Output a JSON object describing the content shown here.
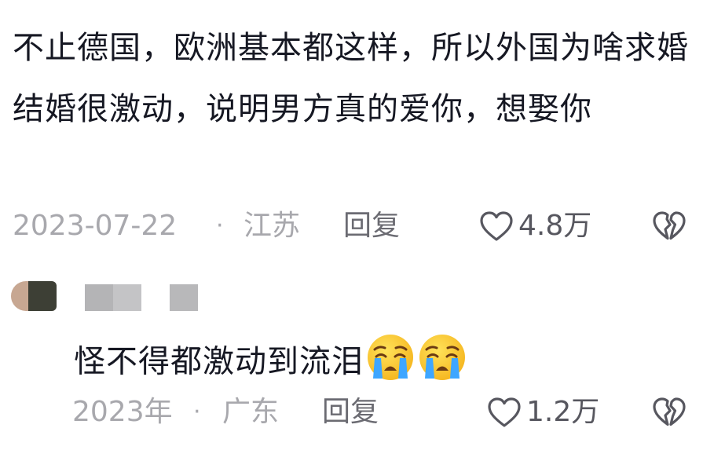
{
  "comment": {
    "text": "不止德国，欧洲基本都这样，所以外国为啥求婚结婚很激动，说明男方真的爱你，想娶你",
    "date": "2023-07-22",
    "separator": "·",
    "location": "江苏",
    "reply_label": "回复",
    "like_count": "4.8万",
    "like_icon": "heart-outline-icon",
    "dislike_icon": "broken-heart-icon"
  },
  "reply": {
    "text": "怪不得都激动到流泪",
    "emojis": [
      "crying-face-emoji",
      "crying-face-emoji"
    ],
    "date": "2023年",
    "separator": "·",
    "location": "广东",
    "reply_label": "回复",
    "like_count": "1.2万",
    "like_icon": "heart-outline-icon",
    "dislike_icon": "broken-heart-icon"
  },
  "colors": {
    "text": "#161823",
    "meta": "#a8a8ad",
    "reply_link": "#6b6b72",
    "icon": "#57575f",
    "emoji_face": "#ffd23c",
    "emoji_tear": "#3ea6ff"
  }
}
